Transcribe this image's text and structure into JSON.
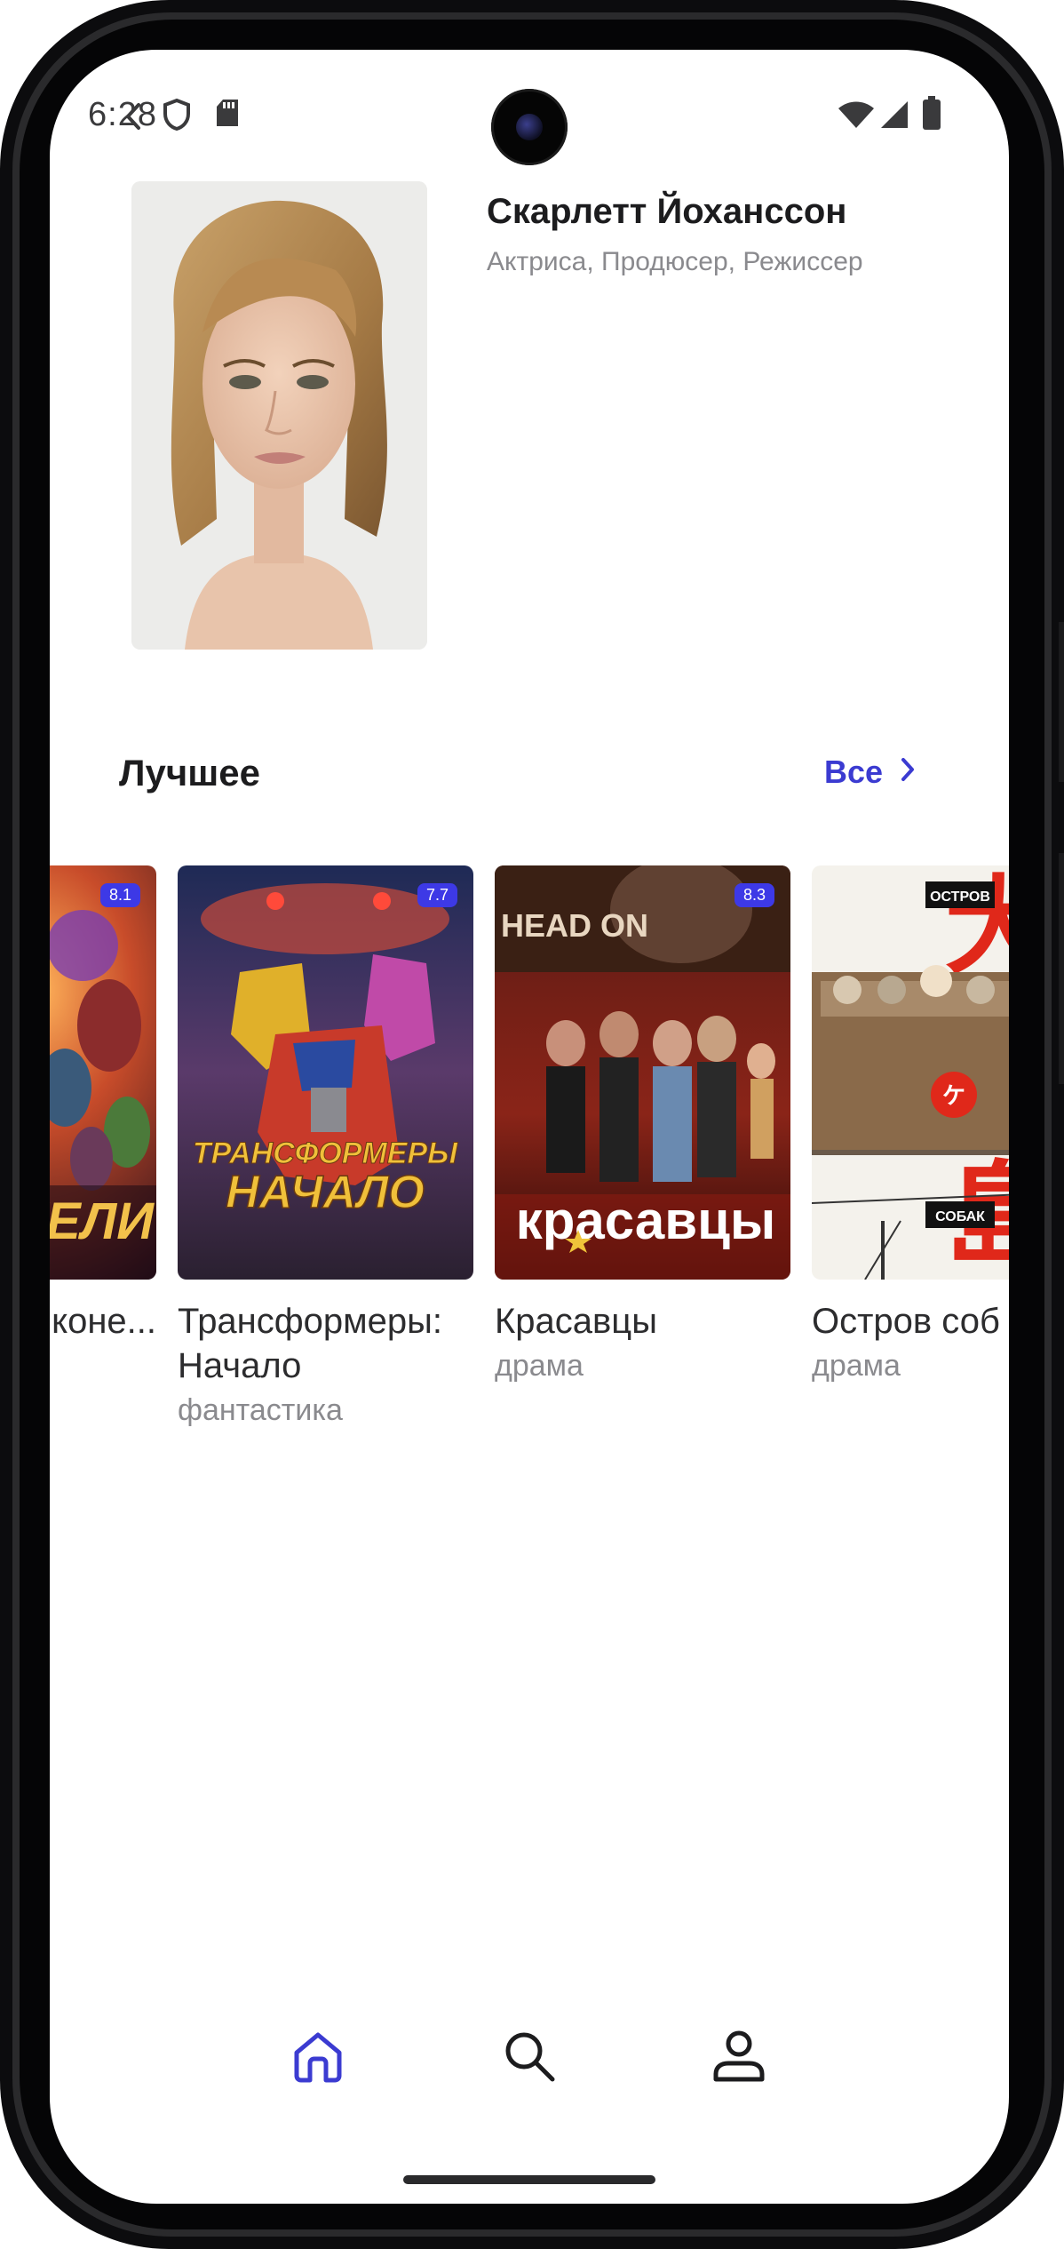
{
  "status_bar": {
    "time": "6:28"
  },
  "person": {
    "name": "Скарлетт Йоханссон",
    "roles": "Актриса, Продюсер, Режиссер"
  },
  "section": {
    "title": "Лучшее",
    "see_all": "Все"
  },
  "movies": [
    {
      "title": "Мстители: Война беско...",
      "visible_title": "коне...",
      "genre": "",
      "rating": "8.1",
      "poster_text": "ТЕЛИ"
    },
    {
      "title": "Трансформеры: Начало",
      "genre": "фантастика",
      "rating": "7.7",
      "poster_text_1": "ТРАНСФОРМЕРЫ",
      "poster_text_2": "НАЧАЛО"
    },
    {
      "title": "Красавцы",
      "genre": "драма",
      "rating": "8.3",
      "poster_text": "красавцы",
      "poster_top": "HEAD ON"
    },
    {
      "title": "Остров соб",
      "genre": "драма",
      "rating": "",
      "poster_tag_1": "ОСТРОВ",
      "poster_tag_2": "СОБАК"
    }
  ],
  "nav": {
    "items": [
      {
        "icon": "home-icon",
        "active": true
      },
      {
        "icon": "search-icon",
        "active": false
      },
      {
        "icon": "profile-icon",
        "active": false
      }
    ]
  },
  "colors": {
    "accent": "#3b3bd1",
    "rating_badge": "#3d39e6",
    "text_primary": "#1c1c1e",
    "text_secondary": "#8a8a8e"
  }
}
